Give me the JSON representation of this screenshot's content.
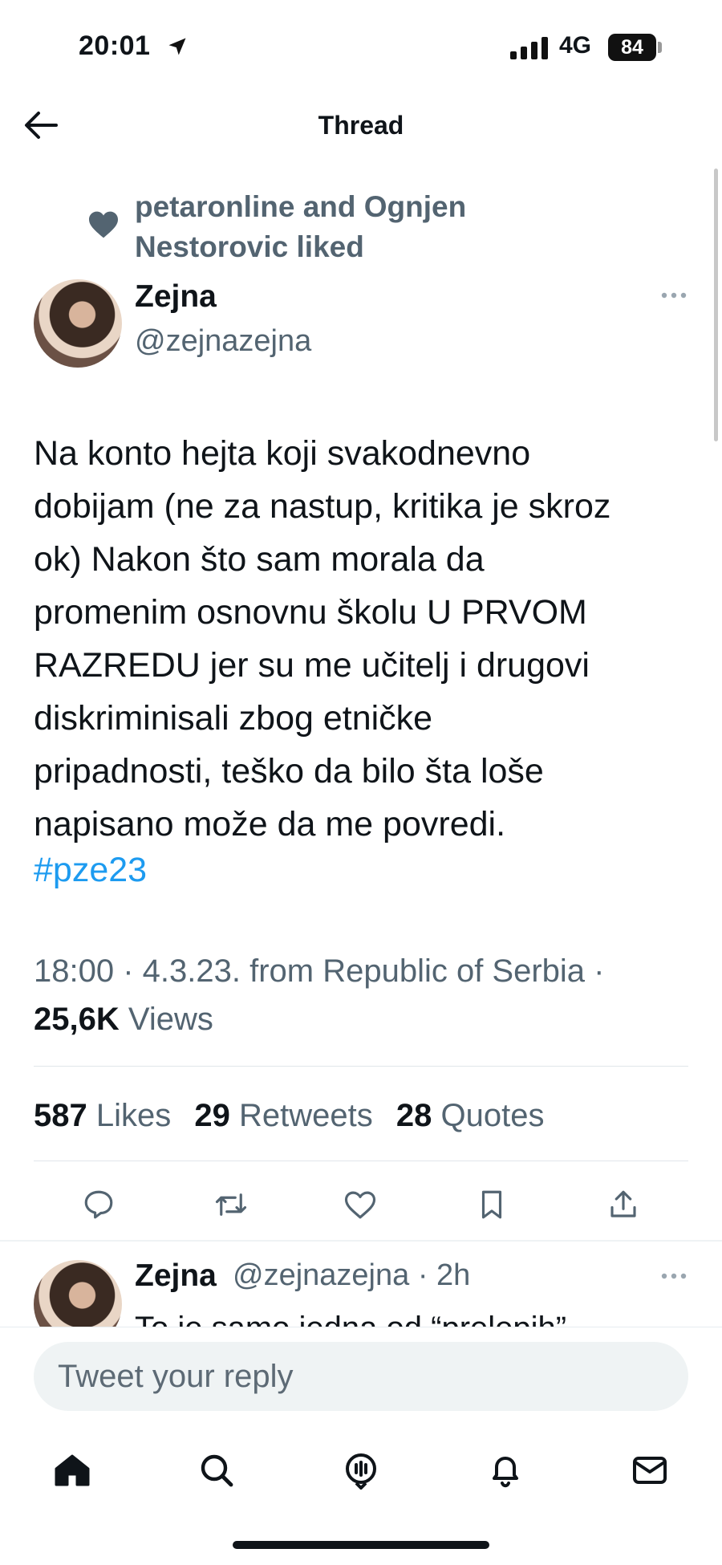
{
  "status_bar": {
    "time": "20:01",
    "network": "4G",
    "battery": "84"
  },
  "header": {
    "title": "Thread"
  },
  "social_context": {
    "text": "petaronline and Ognjen Nestorovic liked"
  },
  "tweet": {
    "author_name": "Zejna",
    "author_handle": "@zejnazejna",
    "body": "Na konto hejta koji svakodnevno\ndobijam (ne za nastup, kritika je skroz\nok) Nakon što sam morala da\npromenim osnovnu školu U PRVOM\nRAZREDU jer su me učitelj i drugovi\ndiskriminisali zbog etničke\npripadnosti, teško da bilo šta loše\nnapisano može da me povredi.",
    "hashtag": "#pze23",
    "meta": "18:00 · 4.3.23. from Republic of Serbia ·",
    "views_count": "25,6K",
    "views_label": "Views",
    "likes_count": "587",
    "likes_label": "Likes",
    "retweets_count": "29",
    "retweets_label": "Retweets",
    "quotes_count": "28",
    "quotes_label": "Quotes"
  },
  "reply_preview": {
    "author_name": "Zejna",
    "handle_time": "@zejnazejna · 2h",
    "text": "To je samo jedna od “prelepih”"
  },
  "composer": {
    "placeholder": "Tweet your reply"
  },
  "icons": {
    "actions": [
      "reply-icon",
      "retweet-icon",
      "like-icon",
      "bookmark-icon",
      "share-icon"
    ],
    "nav": [
      "home-icon",
      "search-icon",
      "spaces-icon",
      "notifications-icon",
      "messages-icon"
    ]
  },
  "colors": {
    "accent": "#1d9bf0",
    "secondary_text": "#536471",
    "primary_text": "#0f1419"
  }
}
